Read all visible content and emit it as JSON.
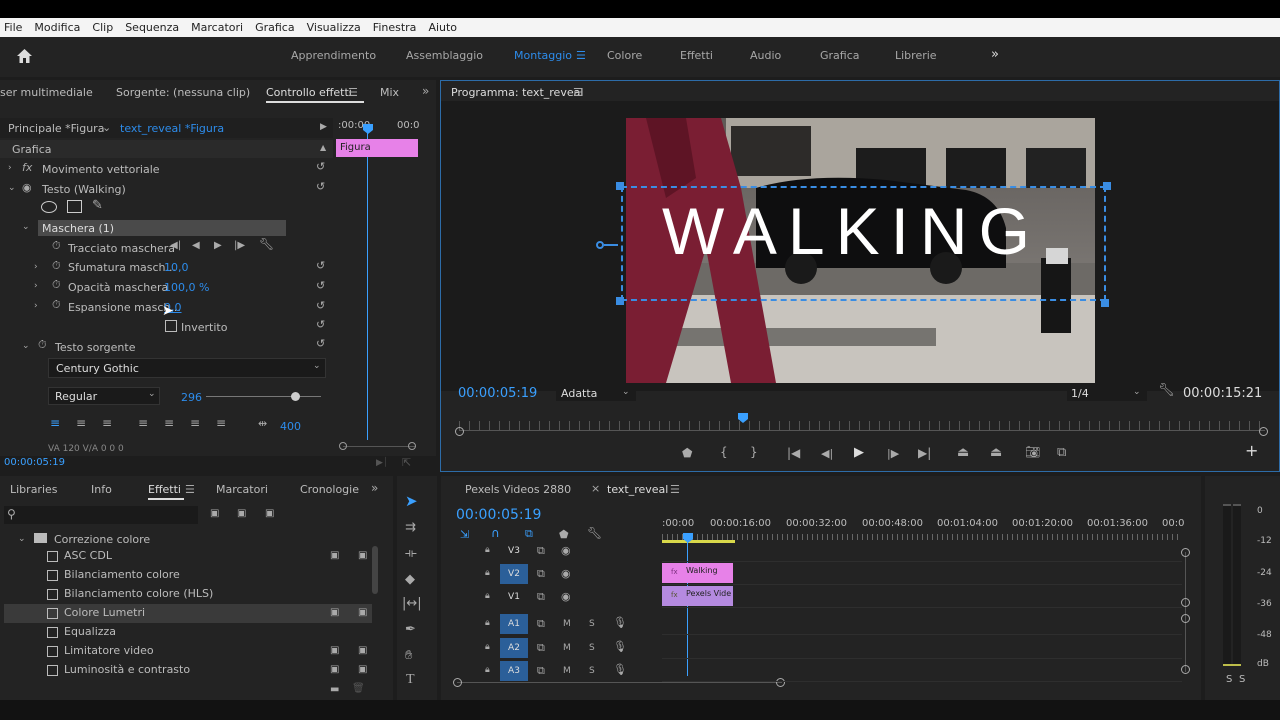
{
  "menu": [
    "File",
    "Modifica",
    "Clip",
    "Sequenza",
    "Marcatori",
    "Grafica",
    "Visualizza",
    "Finestra",
    "Aiuto"
  ],
  "workspaces": [
    "Apprendimento",
    "Assemblaggio",
    "Montaggio",
    "Colore",
    "Effetti",
    "Audio",
    "Grafica",
    "Librerie"
  ],
  "workspace_active": "Montaggio",
  "source_tabs": {
    "media": "ser multimediale",
    "source": "Sorgente: (nessuna clip)",
    "effect_controls": "Controllo effetti",
    "mix": "Mix"
  },
  "effect_controls": {
    "master": "Principale *Figura",
    "clip": "text_reveal *Figura",
    "timecode_start": ":00:00",
    "timecode_end": "00:0",
    "clip_bar": "Figura",
    "section": "Grafica",
    "motion": "Movimento vettoriale",
    "text_layer": "Testo (Walking)",
    "mask": "Maschera (1)",
    "mask_path": "Tracciato maschera",
    "feather_label": "Sfumatura masch...",
    "feather_value": "10,0",
    "opacity_label": "Opacità maschera",
    "opacity_value": "100,0 %",
    "expansion_label": "Espansione masch...",
    "expansion_value": "0,0",
    "inverted": "Invertito",
    "source_text": "Testo sorgente",
    "font": "Century Gothic",
    "font_style": "Regular",
    "font_size": "296",
    "tracking": "400",
    "kerning_row": "VA 120   V/A 0   0   0",
    "current_time": "00:00:05:19"
  },
  "program": {
    "title": "Programma: text_reveal",
    "overlay_text": "WALKING",
    "timecode": "00:00:05:19",
    "fit": "Adatta",
    "resolution": "1/4",
    "duration": "00:00:15:21"
  },
  "project": {
    "tabs": [
      "Libraries",
      "Info",
      "Effetti",
      "Marcatori",
      "Cronologie"
    ],
    "active_tab": "Effetti",
    "folder": "Correzione colore",
    "items": [
      "ASC CDL",
      "Bilanciamento colore",
      "Bilanciamento colore (HLS)",
      "Colore Lumetri",
      "Equalizza",
      "Limitatore video",
      "Luminosità e contrasto"
    ],
    "selected": "Colore Lumetri"
  },
  "timeline": {
    "tabs": [
      "Pexels Videos 2880",
      "text_reveal"
    ],
    "timecode": "00:00:05:19",
    "ruler": [
      ":00:00",
      "00:00:16:00",
      "00:00:32:00",
      "00:00:48:00",
      "00:01:04:00",
      "00:01:20:00",
      "00:01:36:00",
      "00:0"
    ],
    "video_tracks": [
      "V3",
      "V2",
      "V1"
    ],
    "audio_tracks": [
      "A1",
      "A2",
      "A3"
    ],
    "clip_v2": "Walking",
    "clip_v1": "Pexels Vide",
    "meter_scale": [
      "0",
      "-12",
      "-24",
      "-36",
      "-48",
      "dB"
    ],
    "meter_solo": [
      "S",
      "S"
    ]
  },
  "colors": {
    "accent": "#2d8ceb",
    "clip_pink": "#e781e8",
    "clip_purple": "#b58ae0",
    "bg": "#232323"
  }
}
